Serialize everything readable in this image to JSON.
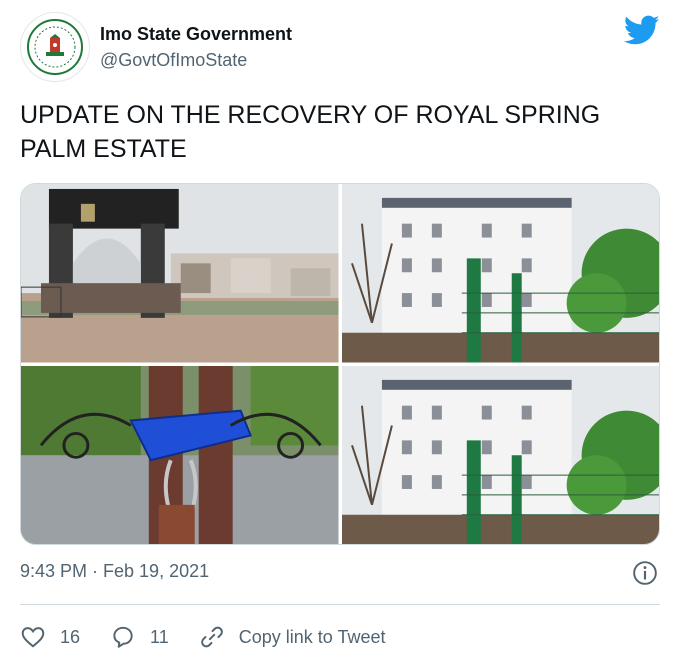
{
  "account": {
    "name": "Imo State Government",
    "handle": "@GovtOfImoState"
  },
  "tweet": {
    "text": "UPDATE ON THE RECOVERY OF ROYAL SPRING PALM ESTATE",
    "timestamp": "9:43 PM · Feb 19, 2021"
  },
  "actions": {
    "likes": "16",
    "replies": "11",
    "copy_link": "Copy link to Tweet"
  },
  "colors": {
    "twitter_blue": "#1d9bf0",
    "secondary_text": "#536471",
    "seal_green": "#1f7a3a",
    "seal_red": "#c0392b"
  },
  "icons": [
    "twitter-bird-icon",
    "info-icon",
    "heart-icon",
    "reply-icon",
    "link-icon"
  ]
}
